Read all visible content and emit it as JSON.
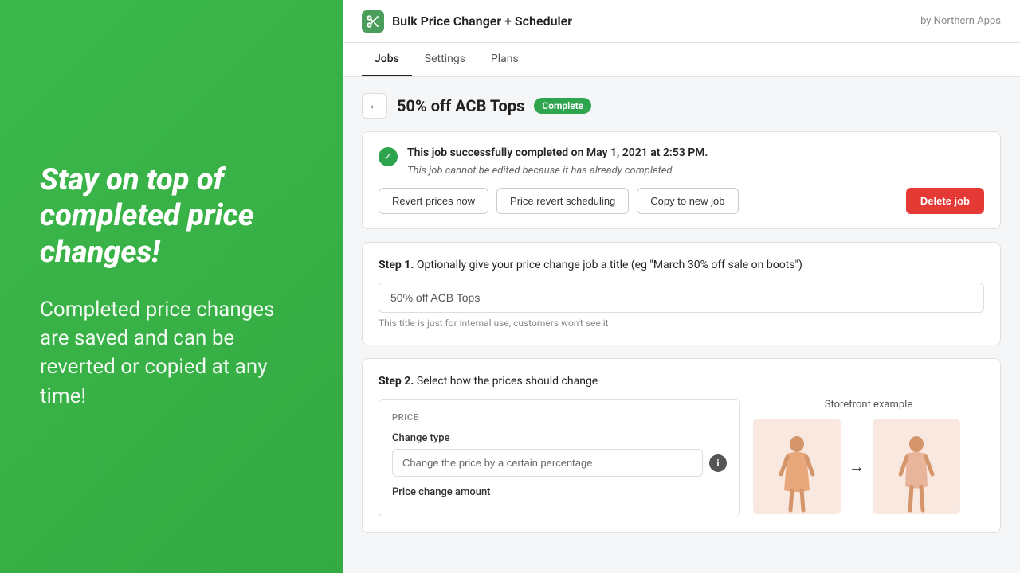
{
  "left": {
    "heading": "Stay on top of completed price changes!",
    "body": "Completed price changes are saved and can be reverted or copied at any time!"
  },
  "header": {
    "app_title": "Bulk Price Changer + Scheduler",
    "by": "by Northern Apps",
    "logo_icon": "✂"
  },
  "nav": {
    "tabs": [
      "Jobs",
      "Settings",
      "Plans"
    ],
    "active": "Jobs"
  },
  "page": {
    "title": "50% off ACB Tops",
    "status": "Complete",
    "back_label": "←"
  },
  "alert": {
    "success_text": "This job successfully completed on May 1, 2021 at 2:53 PM.",
    "note": "This job cannot be edited because it has already completed.",
    "btn_revert": "Revert prices now",
    "btn_schedule": "Price revert scheduling",
    "btn_copy": "Copy to new job",
    "btn_delete": "Delete job"
  },
  "step1": {
    "label": "Step 1.",
    "description": "Optionally give your price change job a title (eg \"March 30% off sale on boots\")",
    "value": "50% off ACB Tops",
    "hint": "This title is just for internal use, customers won't see it"
  },
  "step2": {
    "label": "Step 2.",
    "description": "Select how the prices should change",
    "price_section_title": "PRICE",
    "change_type_label": "Change type",
    "change_type_value": "Change the price by a certain percentage",
    "price_change_amount_label": "Price change amount",
    "storefront_title": "Storefront example",
    "arrow": "→"
  }
}
